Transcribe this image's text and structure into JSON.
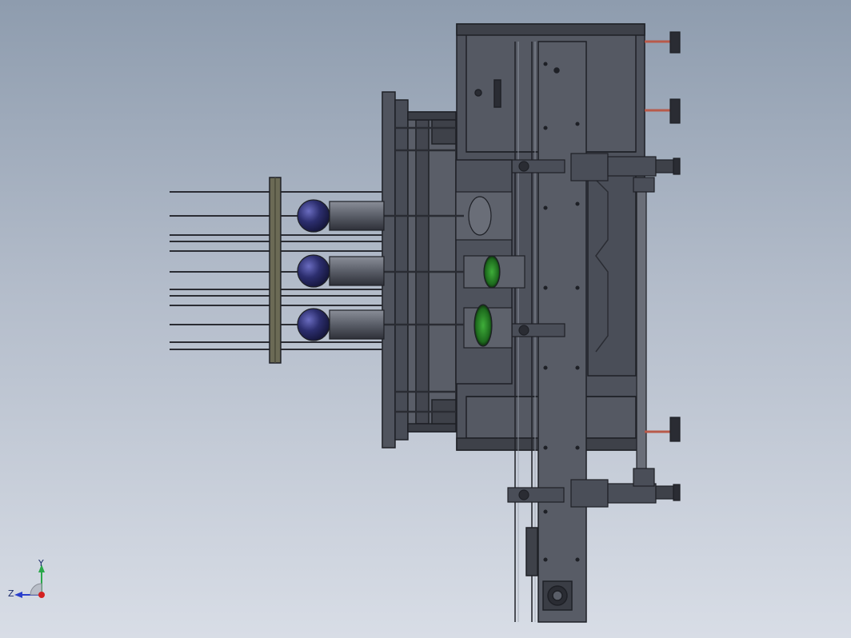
{
  "viewport": {
    "background_top": "#8e9cae",
    "background_bottom": "#d8dde6"
  },
  "model": {
    "frame_color": "#4b4f59",
    "plate_color": "#585c66",
    "sphere_color": "#2c2e6e",
    "lens_color": "#2f8a2c",
    "cylinder_color": "#b85a4a"
  },
  "triad": {
    "y_label": "Y",
    "z_label": "Z",
    "y_color": "#2aa84a",
    "z_color": "#2a3fcc",
    "x_color": "#d42020"
  }
}
